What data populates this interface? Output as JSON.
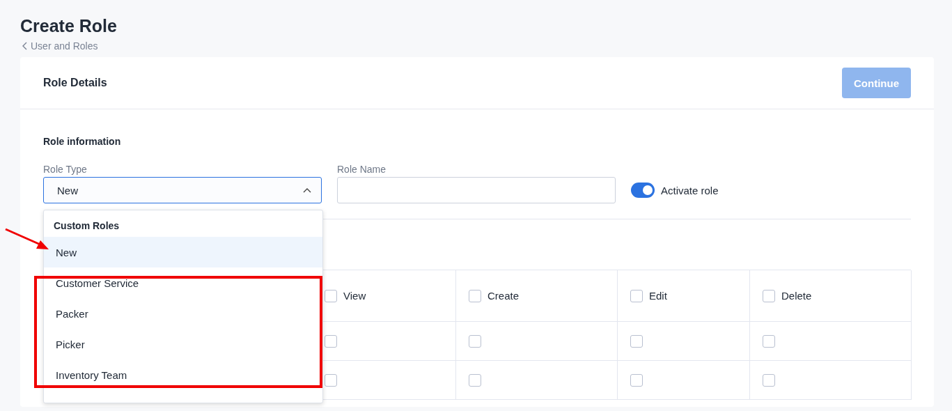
{
  "page": {
    "title": "Create Role",
    "breadcrumb": "User and Roles"
  },
  "card": {
    "title": "Role Details",
    "continue_button": {
      "label": "Continue",
      "disabled": true
    }
  },
  "role_information": {
    "heading": "Role information",
    "role_type": {
      "label": "Role Type",
      "value": "New",
      "expanded": true
    },
    "role_name": {
      "label": "Role Name"
    },
    "activate": {
      "label": "Activate role",
      "on": true
    }
  },
  "dropdown": {
    "group": "Custom Roles",
    "options": [
      {
        "label": "New",
        "selected": true
      },
      {
        "label": "Customer Service",
        "selected": false
      },
      {
        "label": "Packer",
        "selected": false
      },
      {
        "label": "Picker",
        "selected": false
      },
      {
        "label": "Inventory Team",
        "selected": false
      }
    ]
  },
  "permissions": {
    "columns": [
      {
        "label": "View",
        "checked": false
      },
      {
        "label": "Create",
        "checked": false
      },
      {
        "label": "Edit",
        "checked": false
      },
      {
        "label": "Delete",
        "checked": false
      }
    ],
    "rows": [
      {
        "checks": [
          false,
          false,
          false,
          false
        ]
      },
      {
        "checks": [
          false,
          false,
          false,
          false
        ]
      }
    ]
  }
}
